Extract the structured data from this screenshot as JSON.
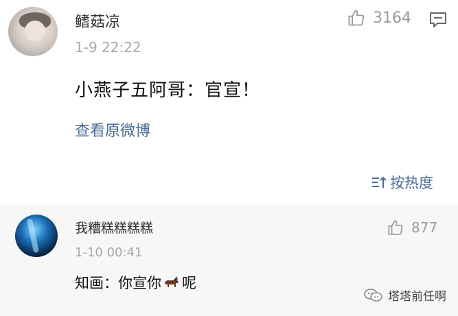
{
  "post": {
    "username": "鳍菇凉",
    "timestamp": "1-9 22:22",
    "text": "小燕子五阿哥：官宣！",
    "like_count": "3164",
    "view_original_label": "查看原微博"
  },
  "sort": {
    "label": "按热度"
  },
  "reply": {
    "username": "我糟糕糕糕糕",
    "timestamp": "1-10 00:41",
    "text_before": "知画：你宣你",
    "text_after": "呢",
    "like_count": "877"
  },
  "watermark": {
    "label": "塔塔前任啊"
  },
  "colors": {
    "link": "#4a6b93",
    "muted": "#a8a8a8",
    "reply_bg": "#f7f7f7"
  },
  "icons": {
    "like": "thumbs-up-icon",
    "reply": "comment-bubble-icon",
    "sort": "sort-icon",
    "emoji": "horse-emoji",
    "watermark": "wechat-icon"
  }
}
